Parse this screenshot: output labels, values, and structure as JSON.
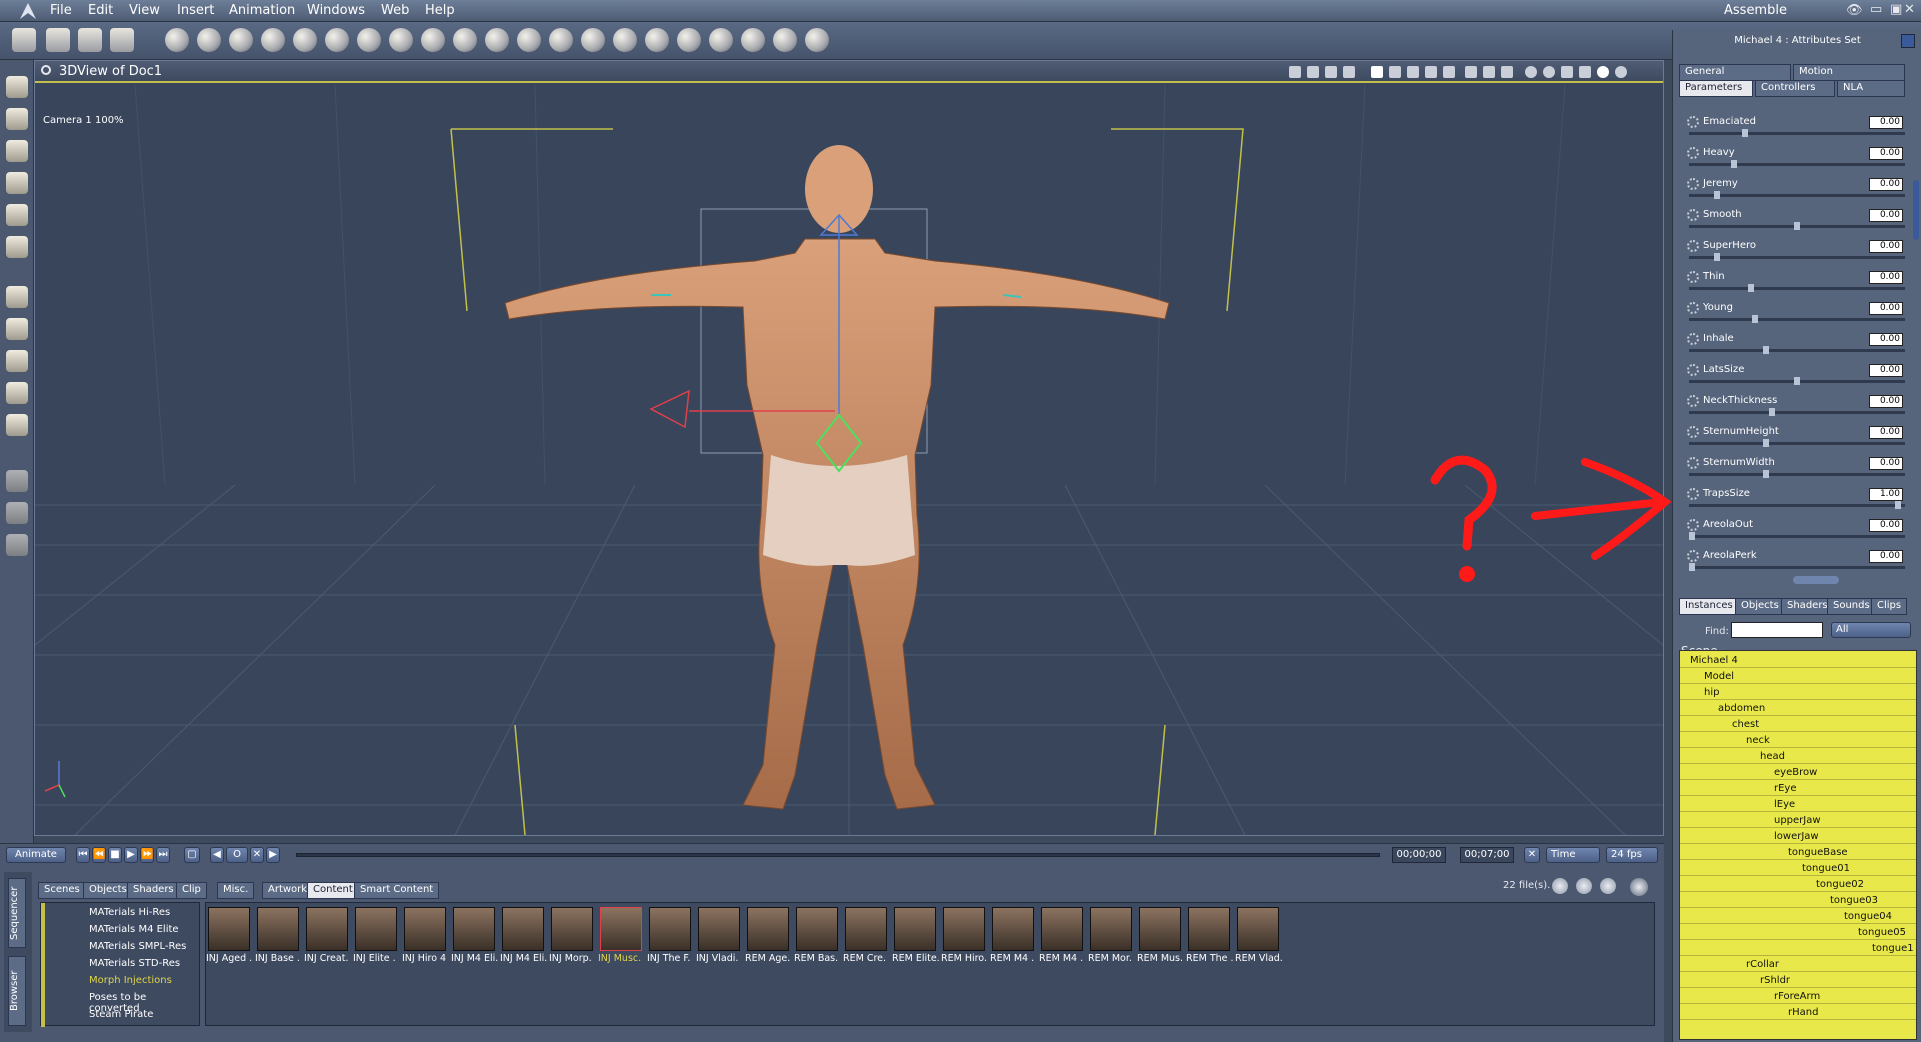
{
  "menubar": {
    "items": [
      "File",
      "Edit",
      "View",
      "Insert",
      "Animation",
      "Windows",
      "Web",
      "Help"
    ],
    "workspace": "Assemble"
  },
  "viewport": {
    "title": "3DView of Doc1",
    "camera": "Camera 1 100%"
  },
  "timeline": {
    "animate_label": "Animate",
    "current_time": "00;00;00",
    "end_time": "00;07;00",
    "time_mode": "Time",
    "fps": "24 fps"
  },
  "content": {
    "side_tabs": [
      "Sequencer",
      "Browser"
    ],
    "tabs": [
      "Scenes",
      "Objects",
      "Shaders",
      "Clip",
      "Misc.",
      "Artwork",
      "Content",
      "Smart Content"
    ],
    "active_tab": "Content",
    "file_count": "22 file(s).",
    "tree": [
      "MATerials Hi-Res",
      "MATerials M4 Elite",
      "MATerials SMPL-Res",
      "MATerials STD-Res",
      "Morph Injections",
      "Poses to be converted",
      "Steam Pirate"
    ],
    "thumbnails": [
      "INJ Aged .",
      "INJ Base .",
      "INJ Creat.",
      "INJ Elite .",
      "INJ Hiro 4",
      "INJ M4 Eli.",
      "INJ M4 Eli.",
      "INJ Morp.",
      "INJ Musc.",
      "INJ The F.",
      "INJ Vladi.",
      "REM Age.",
      "REM Bas.",
      "REM Cre.",
      "REM Elite.",
      "REM Hiro.",
      "REM M4 .",
      "REM M4 .",
      "REM Mor.",
      "REM Mus.",
      "REM The .",
      "REM Vlad."
    ]
  },
  "right_panel": {
    "title": "Michael 4 : Attributes Set",
    "tabs_top": [
      "General",
      "Motion"
    ],
    "tabs_sub": [
      "Parameters",
      "Controllers",
      "NLA"
    ],
    "params": [
      {
        "name": "Emaciated",
        "value": "0.00",
        "level": 0.25
      },
      {
        "name": "Heavy",
        "value": "0.00",
        "level": 0.2
      },
      {
        "name": "Jeremy",
        "value": "0.00",
        "level": 0.12
      },
      {
        "name": "Smooth",
        "value": "0.00",
        "level": 0.5
      },
      {
        "name": "SuperHero",
        "value": "0.00",
        "level": 0.12
      },
      {
        "name": "Thin",
        "value": "0.00",
        "level": 0.28
      },
      {
        "name": "Young",
        "value": "0.00",
        "level": 0.3
      },
      {
        "name": "Inhale",
        "value": "0.00",
        "level": 0.35
      },
      {
        "name": "LatsSize",
        "value": "0.00",
        "level": 0.5
      },
      {
        "name": "NeckThickness",
        "value": "0.00",
        "level": 0.38
      },
      {
        "name": "SternumHeight",
        "value": "0.00",
        "level": 0.35
      },
      {
        "name": "SternumWidth",
        "value": "0.00",
        "level": 0.35
      },
      {
        "name": "TrapsSize",
        "value": "1.00",
        "level": 0.98
      },
      {
        "name": "AreolaOut",
        "value": "0.00",
        "level": 0.0
      },
      {
        "name": "AreolaPerk",
        "value": "0.00",
        "level": 0.0
      }
    ],
    "tabs_bottom": [
      "Instances",
      "Objects",
      "Shaders",
      "Sounds",
      "Clips"
    ],
    "find_label": "Find:",
    "filter": "All",
    "scene_label": "Scene",
    "scene_nodes": [
      {
        "name": "Michael 4",
        "depth": 0
      },
      {
        "name": "Model",
        "depth": 1
      },
      {
        "name": "hip",
        "depth": 1
      },
      {
        "name": "abdomen",
        "depth": 2
      },
      {
        "name": "chest",
        "depth": 3
      },
      {
        "name": "neck",
        "depth": 4
      },
      {
        "name": "head",
        "depth": 5
      },
      {
        "name": "eyeBrow",
        "depth": 6
      },
      {
        "name": "rEye",
        "depth": 6
      },
      {
        "name": "lEye",
        "depth": 6
      },
      {
        "name": "upperJaw",
        "depth": 6
      },
      {
        "name": "lowerJaw",
        "depth": 6
      },
      {
        "name": "tongueBase",
        "depth": 7
      },
      {
        "name": "tongue01",
        "depth": 8
      },
      {
        "name": "tongue02",
        "depth": 9
      },
      {
        "name": "tongue03",
        "depth": 10
      },
      {
        "name": "tongue04",
        "depth": 11
      },
      {
        "name": "tongue05",
        "depth": 12
      },
      {
        "name": "tongue1",
        "depth": 13
      },
      {
        "name": "rCollar",
        "depth": 4
      },
      {
        "name": "rShldr",
        "depth": 5
      },
      {
        "name": "rForeArm",
        "depth": 6
      },
      {
        "name": "rHand",
        "depth": 7
      }
    ]
  },
  "colors": {
    "accent_yellow": "#c2c04a",
    "annotation_red": "#ff1a1a",
    "scene_bg": "#e8e84a"
  }
}
